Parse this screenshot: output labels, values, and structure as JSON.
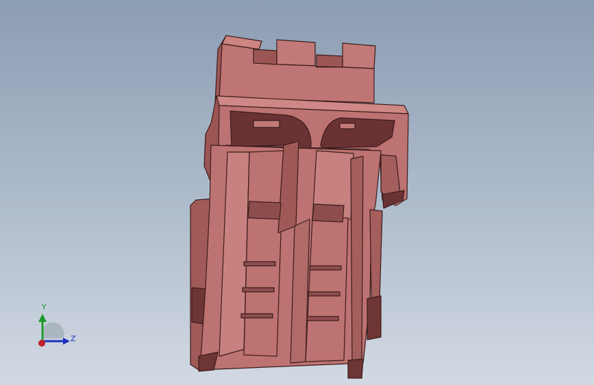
{
  "viewport": {
    "background_top": "#8c9db3",
    "background_bottom": "#d2d9e3"
  },
  "model": {
    "icon": "connector-housing-3d-model",
    "color_main": "#bd7371",
    "color_light": "#cd8582",
    "color_dark": "#8e4d4d",
    "color_shadow": "#5a2b2e",
    "color_edge": "#3a1c1c"
  },
  "triad": {
    "y_label": "Y",
    "z_label": "Z",
    "y_color": "#1f9a2f",
    "z_color": "#1b2fbf",
    "origin_color": "#c0202a"
  }
}
